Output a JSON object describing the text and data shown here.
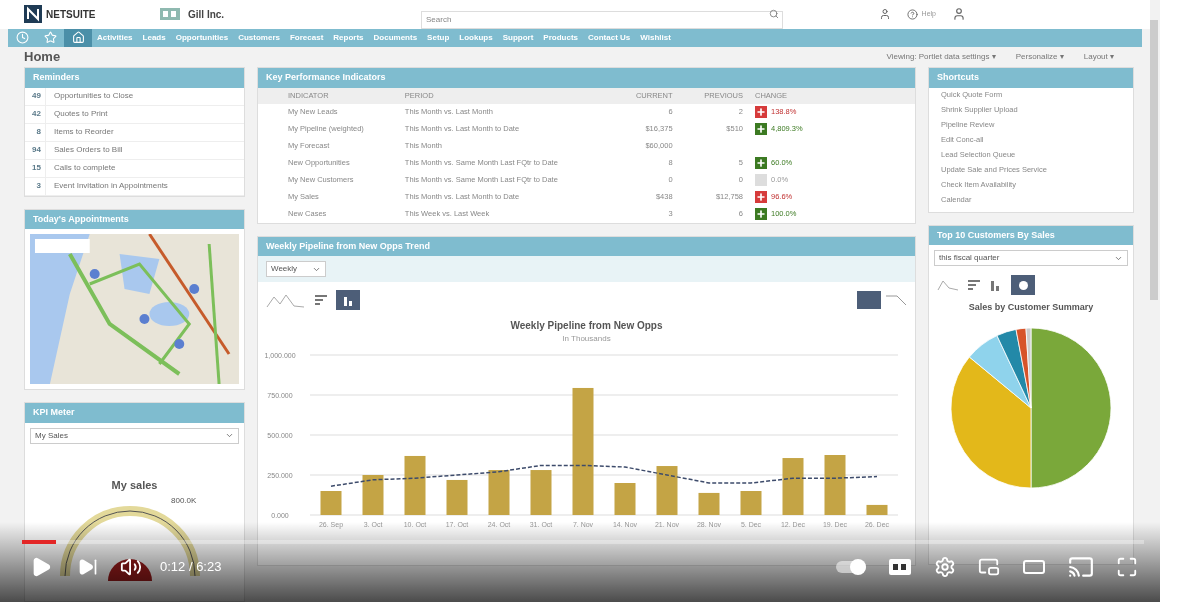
{
  "header": {
    "logo": "NETSUITE",
    "company": "Gill Inc.",
    "search_placeholder": "Search",
    "help": "Help"
  },
  "nav": [
    {
      "kind": "clock",
      "selected": false
    },
    {
      "kind": "star",
      "selected": false
    },
    {
      "kind": "home",
      "selected": true
    },
    {
      "kind": "text",
      "label": "Activities",
      "selected": false
    },
    {
      "kind": "text",
      "label": "Leads",
      "selected": false
    },
    {
      "kind": "text",
      "label": "Opportunities",
      "selected": false
    },
    {
      "kind": "text",
      "label": "Customers",
      "selected": false
    },
    {
      "kind": "text",
      "label": "Forecast",
      "selected": false
    },
    {
      "kind": "text",
      "label": "Reports",
      "selected": false
    },
    {
      "kind": "text",
      "label": "Documents",
      "selected": false
    },
    {
      "kind": "text",
      "label": "Setup",
      "selected": false
    },
    {
      "kind": "text",
      "label": "Lookups",
      "selected": false
    },
    {
      "kind": "text",
      "label": "Support",
      "selected": false
    },
    {
      "kind": "text",
      "label": "Products",
      "selected": false
    },
    {
      "kind": "text",
      "label": "Contact Us",
      "selected": false
    },
    {
      "kind": "text",
      "label": "Wishlist",
      "selected": false
    }
  ],
  "page": {
    "title": "Home",
    "links": [
      "Viewing: Portlet data settings ▾",
      "Personalize ▾",
      "Layout ▾"
    ]
  },
  "reminders": {
    "title": "Reminders",
    "items": [
      {
        "count": "49",
        "label": "Opportunities to Close"
      },
      {
        "count": "42",
        "label": "Quotes to Print"
      },
      {
        "count": "8",
        "label": "Items to Reorder"
      },
      {
        "count": "94",
        "label": "Sales Orders to Bill"
      },
      {
        "count": "15",
        "label": "Calls to complete"
      },
      {
        "count": "3",
        "label": "Event Invitation in Appointments"
      }
    ]
  },
  "appointments": {
    "title": "Today's Appointments"
  },
  "kpi_meter": {
    "title": "KPI Meter",
    "select": "My Sales",
    "gauge_title": "My sales",
    "reading": "800.0K"
  },
  "kpi": {
    "title": "Key Performance Indicators",
    "columns": [
      "INDICATOR",
      "PERIOD",
      "CURRENT",
      "PREVIOUS",
      "CHANGE"
    ],
    "rows": [
      {
        "indicator": "My New Leads",
        "period": "This Month vs. Last Month",
        "current": "6",
        "previous": "2",
        "change": "138.8%",
        "kind": "down"
      },
      {
        "indicator": "My Pipeline (weighted)",
        "period": "This Month vs. Last Month to Date",
        "current": "$16,375",
        "previous": "$510",
        "change": "4,809.3%",
        "kind": "up"
      },
      {
        "indicator": "My Forecast",
        "period": "This Month",
        "current": "$60,000",
        "kind": "blank"
      },
      {
        "indicator": "New Opportunities",
        "period": "This Month vs. Same Month Last FQtr to Date",
        "current": "8",
        "previous": "5",
        "change": "60.0%",
        "kind": "up"
      },
      {
        "indicator": "My New Customers",
        "period": "This Month vs. Same Month Last FQtr to Date",
        "current": "0",
        "previous": "0",
        "change": "0.0%",
        "kind": "flat"
      },
      {
        "indicator": "My Sales",
        "period": "This Month vs. Last Month to Date",
        "current": "$438",
        "previous": "$12,758",
        "change": "96.6%",
        "kind": "down"
      },
      {
        "indicator": "New Cases",
        "period": "This Week vs. Last Week",
        "current": "3",
        "previous": "6",
        "change": "100.0%",
        "kind": "up"
      }
    ]
  },
  "pipeline": {
    "title": "Weekly Pipeline from New Opps Trend",
    "select": "Weekly",
    "chart_data": {
      "type": "bar",
      "title": "Weekly Pipeline from New Opps",
      "subtitle": "In Thousands",
      "categories": [
        "26. Sep",
        "3. Oct",
        "10. Oct",
        "17. Oct",
        "24. Oct",
        "31. Oct",
        "7. Nov",
        "14. Nov",
        "21. Nov",
        "28. Nov",
        "5. Dec",
        "12. Dec",
        "19. Dec",
        "26. Dec"
      ],
      "grid": true,
      "series": [
        {
          "type": "bar",
          "color": "#c4a445",
          "values": [
            150,
            250,
            369,
            219,
            281,
            281,
            794,
            200,
            306,
            138,
            150,
            356,
            375,
            63
          ]
        },
        {
          "type": "line",
          "line_style": "dashed",
          "color": "#3d4b6b",
          "values": [
            180,
            220,
            230,
            250,
            270,
            310,
            310,
            300,
            250,
            200,
            200,
            230,
            230,
            240
          ]
        }
      ],
      "ylim": [
        0,
        1000
      ],
      "yticks": [
        {
          "value": 0,
          "label": "0.000"
        },
        {
          "value": 250,
          "label": "250.000"
        },
        {
          "value": 500,
          "label": "500.000"
        },
        {
          "value": 750,
          "label": "750.000"
        },
        {
          "value": 1000,
          "label": "1,000.000"
        }
      ]
    }
  },
  "shortcuts": {
    "title": "Shortcuts",
    "items": [
      "Quick Quote Form",
      "Shrink Supplier Upload",
      "Pipeline Review",
      "Edit Conc-all",
      "Lead Selection Queue",
      "Update Sale and Prices Service",
      "Check Item Availability",
      "Calendar"
    ]
  },
  "top_customers": {
    "title": "Top 10 Customers By Sales",
    "select": "this fiscal quarter",
    "chart_title": "Sales by Customer Summary"
  },
  "player": {
    "progress": {
      "level": 0.03
    },
    "time": "0:12 / 6:23",
    "autoplay": {
      "on": true
    }
  }
}
